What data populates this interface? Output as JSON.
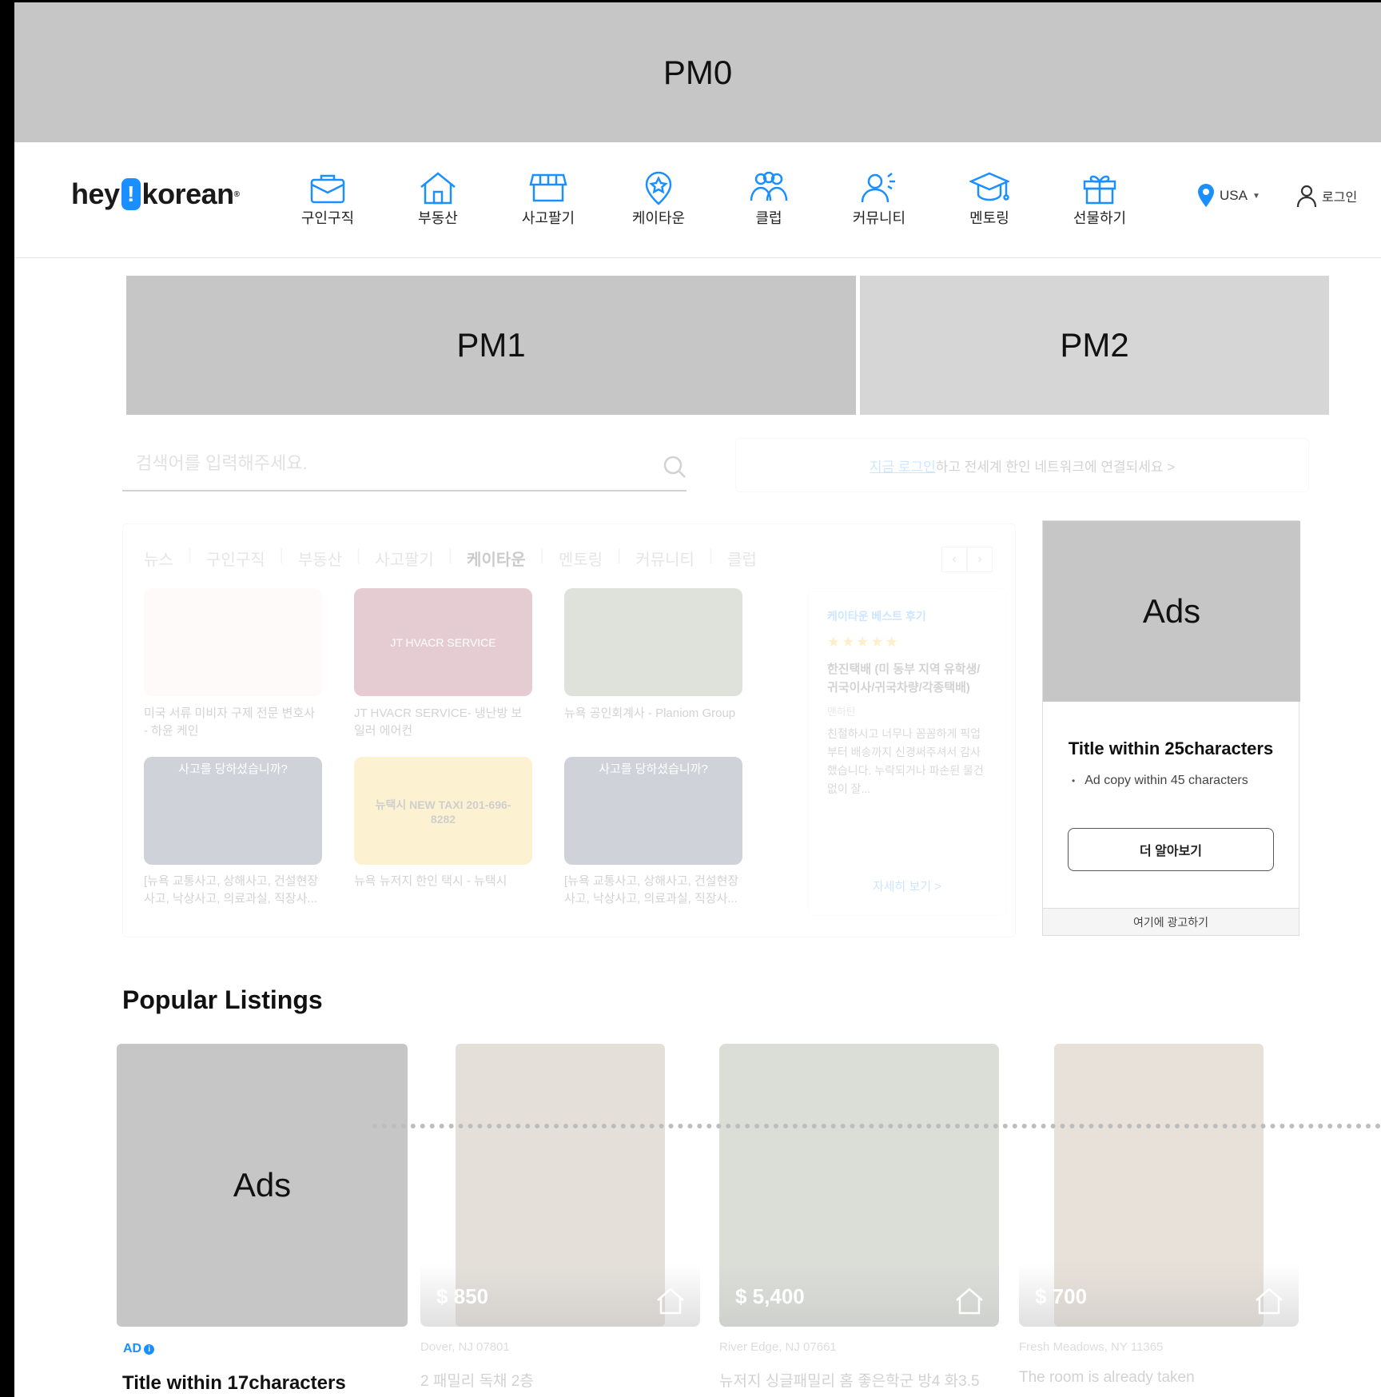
{
  "pm0": "PM0",
  "pm1": "PM1",
  "pm2": "PM2",
  "header": {
    "logo_left": "hey",
    "logo_bang": "!",
    "logo_right": "korean",
    "logo_mark": "®",
    "nav": [
      {
        "label": "구인구직",
        "icon": "briefcase-icon"
      },
      {
        "label": "부동산",
        "icon": "house-icon"
      },
      {
        "label": "사고팔기",
        "icon": "storefront-icon"
      },
      {
        "label": "케이타운",
        "icon": "map-pin-star-icon"
      },
      {
        "label": "클럽",
        "icon": "group-icon"
      },
      {
        "label": "커뮤니티",
        "icon": "community-icon"
      },
      {
        "label": "멘토링",
        "icon": "graduation-cap-icon"
      },
      {
        "label": "선물하기",
        "icon": "gift-icon"
      }
    ],
    "location": "USA",
    "login": "로그인"
  },
  "search": {
    "placeholder": "검색어를 입력해주세요."
  },
  "login_banner": {
    "link": "지금 로그인",
    "rest": "하고 전세계 한인 네트워크에 연결되세요 >"
  },
  "tabs": [
    "뉴스",
    "구인구직",
    "부동산",
    "사고팔기",
    "케이타운",
    "멘토링",
    "커뮤니티",
    "클럽"
  ],
  "active_tab": "케이타운",
  "cards": [
    {
      "caption": "미국 서류 미비자 구제 전문 변호사 - 하윤 케인",
      "color": "#f3e7e2"
    },
    {
      "caption": "JT HVACR SERVICE- 냉난방 보일러 에어컨",
      "color": "#8a1838",
      "thumb_text": "JT HVACR SERVICE"
    },
    {
      "caption": "뉴욕 공인회계사 - Planiom Group",
      "color": "#6b7b5b"
    },
    {
      "caption": "[뉴욕 교통사고, 상해사고, 건설현장 사고, 낙상사고, 의료과실, 직장사...",
      "color": "#25324d",
      "thumb_text": "사고를 당하셨습니까?"
    },
    {
      "caption": "뉴욕 뉴저지 한인 택시 - 뉴택시",
      "color": "#f2c230",
      "thumb_text": "뉴택시 NEW TAXI 201-696-8282"
    },
    {
      "caption": "[뉴욕 교통사고, 상해사고, 건설현장 사고, 낙상사고, 의료과실, 직장사...",
      "color": "#25324d",
      "thumb_text": "사고를 당하셨습니까?"
    }
  ],
  "review": {
    "heading": "케이타운 베스트 후기",
    "stars": "★★★★★",
    "title": "한진택배 (미 동부 지역 유학생/귀국이사/귀국차량/각종택배)",
    "author": "맨하탄",
    "body": "친절하시고 너무나 꼼꼼하게 픽업부터 배송까지 신경써주셔서 감사했습니다. 누락되거나 파손된 물건 없이 잘...",
    "more": "자세히 보기 >"
  },
  "ad_card": {
    "image_label": "Ads",
    "title": "Title within 25characters",
    "copy": "Ad copy within 45 characters",
    "button": "더 알아보기",
    "footer": "여기에 광고하기"
  },
  "popular": {
    "title": "Popular Listings",
    "ad": {
      "image_label": "Ads",
      "tag": "AD",
      "title": "Title within 17characters"
    },
    "listings": [
      {
        "price": "$ 850",
        "location": "Dover, NJ 07801",
        "title": "2 패밀리 독채 2층",
        "color": "#8a7458"
      },
      {
        "price": "$ 5,400",
        "location": "River Edge, NJ 07661",
        "title": "뉴저지 싱글패밀리 홈 좋은학군 방4 화3.5",
        "color": "#5d6d4e"
      },
      {
        "price": "$ 700",
        "location": "Fresh Meadows, NY 11365",
        "title": "The room is already taken",
        "color": "#9b7a55"
      }
    ]
  }
}
